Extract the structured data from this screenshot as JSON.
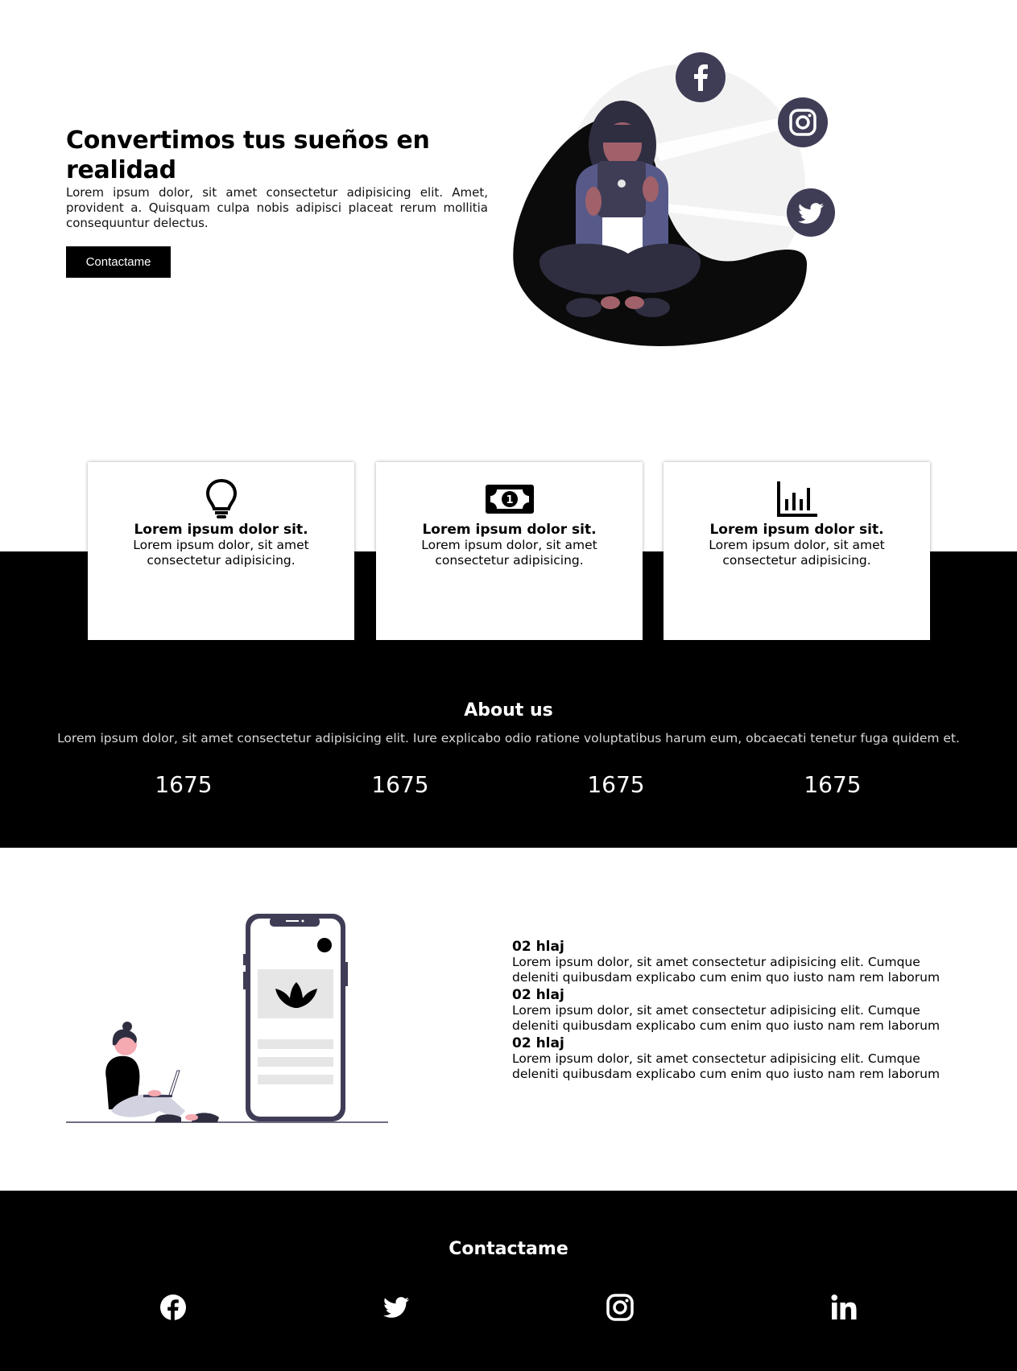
{
  "hero": {
    "title": "Convertimos tus sueños en realidad",
    "description": "Lorem ipsum dolor, sit amet consectetur adipisicing elit. Amet, provident a. Quisquam culpa nobis adipisci placeat rerum mollitia consequuntur delectus.",
    "button_label": "Contactame"
  },
  "cards": [
    {
      "icon": "lightbulb-icon",
      "title": "Lorem ipsum dolor sit.",
      "desc": "Lorem ipsum dolor, sit amet consectetur adipisicing."
    },
    {
      "icon": "money-bill-icon",
      "title": "Lorem ipsum dolor sit.",
      "desc": "Lorem ipsum dolor, sit amet consectetur adipisicing."
    },
    {
      "icon": "bar-chart-icon",
      "title": "Lorem ipsum dolor sit.",
      "desc": "Lorem ipsum dolor, sit amet consectetur adipisicing."
    }
  ],
  "about": {
    "title": "About us",
    "description": "Lorem ipsum dolor, sit amet consectetur adipisicing elit. Iure explicabo odio ratione voluptatibus harum eum, obcaecati tenetur fuga quidem et.",
    "stats": [
      "1675",
      "1675",
      "1675",
      "1675"
    ]
  },
  "features": [
    {
      "title": "02 hlaj",
      "desc": "Lorem ipsum dolor, sit amet consectetur adipisicing elit. Cumque deleniti quibusdam explicabo cum enim quo iusto nam rem laborum"
    },
    {
      "title": "02 hlaj",
      "desc": "Lorem ipsum dolor, sit amet consectetur adipisicing elit. Cumque deleniti quibusdam explicabo cum enim quo iusto nam rem laborum"
    },
    {
      "title": "02 hlaj",
      "desc": "Lorem ipsum dolor, sit amet consectetur adipisicing elit. Cumque deleniti quibusdam explicabo cum enim quo iusto nam rem laborum"
    }
  ],
  "footer": {
    "title": "Contactame",
    "socials": [
      "facebook-icon",
      "twitter-icon",
      "instagram-icon",
      "linkedin-icon"
    ]
  },
  "colors": {
    "accent_dark": "#3f3d56",
    "accent_purple": "#575a89",
    "skin": "#a0616a",
    "blob_light": "#f2f2f2",
    "black": "#000000"
  }
}
